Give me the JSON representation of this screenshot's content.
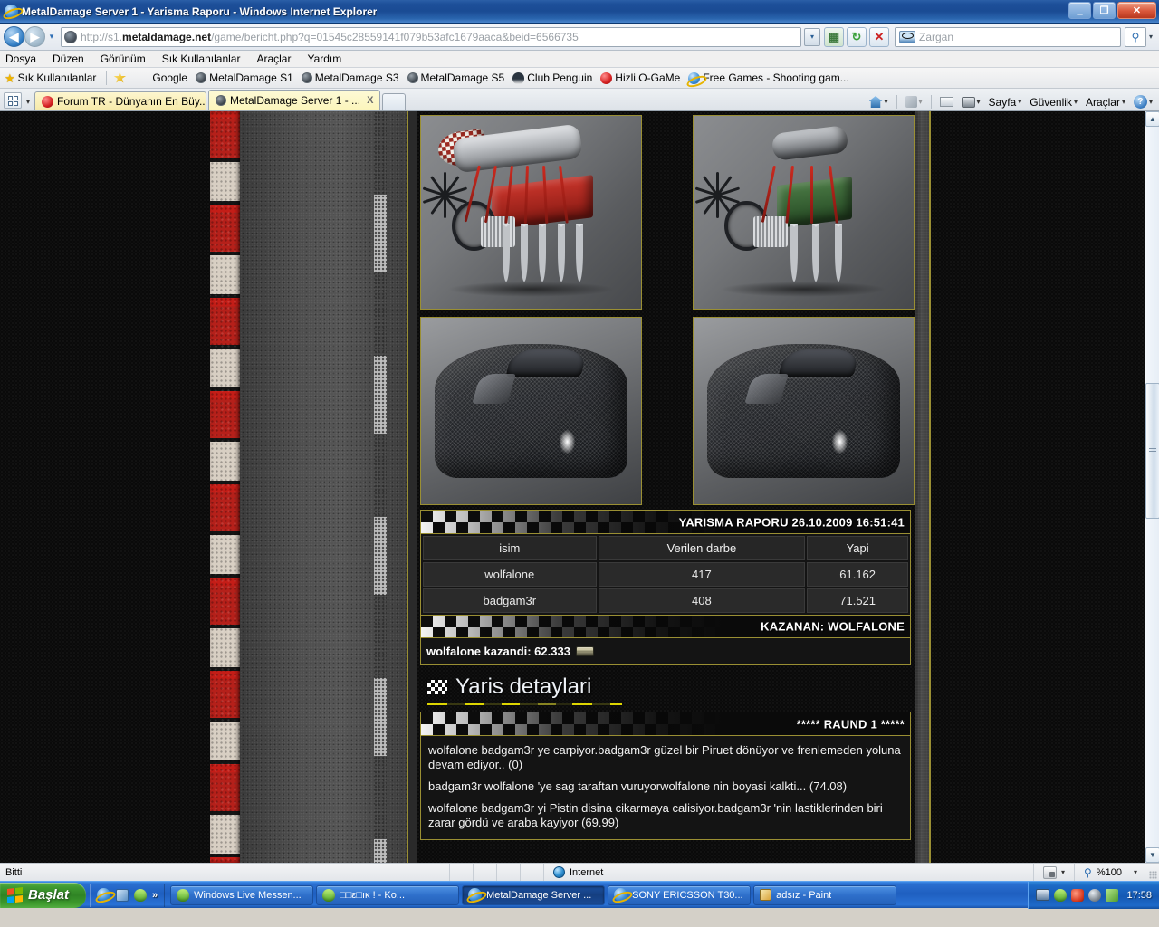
{
  "window": {
    "title": "MetalDamage Server 1 - Yarisma Raporu - Windows Internet Explorer",
    "icon": "internet-explorer-icon",
    "minimize_label": "_",
    "restore_label": "❐",
    "close_label": "✕"
  },
  "nav": {
    "back_label": "◀",
    "forward_label": "▶",
    "recent_caret": "▾",
    "url_scheme": "http://s1.",
    "url_domain": "metaldamage.net",
    "url_path": "/game/bericht.php?q=01545c28559141f079b53afc1679aaca&beid=6566735",
    "url_full": "http://s1.metaldamage.net/game/bericht.php?q=01545c28559141f079b53afc1679aaca&beid=6566735",
    "address_dropdown_label": "▾",
    "compat_view_label": "⬚",
    "refresh_label": "↻",
    "stop_label": "✕",
    "search_placeholder": "Zargan",
    "search_go_label": "⚲",
    "search_caret": "▾"
  },
  "menu": {
    "items": [
      "Dosya",
      "Düzen",
      "Görünüm",
      "Sık Kullanılanlar",
      "Araçlar",
      "Yardım"
    ]
  },
  "favorites": {
    "button_label": "Sık Kullanılanlar",
    "add_icon": "add-favorite-icon",
    "items": [
      {
        "label": "Google",
        "icon": "google-icon"
      },
      {
        "label": "MetalDamage S1",
        "icon": "metaldamage-icon"
      },
      {
        "label": "MetalDamage S3",
        "icon": "metaldamage-icon"
      },
      {
        "label": "MetalDamage S5",
        "icon": "metaldamage-icon"
      },
      {
        "label": "Club Penguin",
        "icon": "club-penguin-icon"
      },
      {
        "label": "Hizli O-GaMe",
        "icon": "ogame-icon"
      },
      {
        "label": "Free Games - Shooting gam...",
        "icon": "internet-explorer-icon"
      }
    ]
  },
  "tabs": {
    "quick_tabs_label": "Quick Tabs",
    "tab_list_caret": "▾",
    "items": [
      {
        "label": "Forum TR - Dünyanın En Büy...",
        "icon": "forum-tr-icon",
        "active": false
      },
      {
        "label": "MetalDamage Server 1 - ...",
        "icon": "metaldamage-icon",
        "active": true
      }
    ],
    "close_label": "X"
  },
  "command_bar": {
    "home_label": "",
    "home_caret": "▾",
    "feeds_caret": "▾",
    "read_mail_label": "",
    "print_caret": "▾",
    "page_label": "Sayfa",
    "security_label": "Güvenlik",
    "tools_label": "Araçlar",
    "help_label": "?",
    "help_caret": "▾"
  },
  "page": {
    "images": [
      {
        "name": "engine-red-v8",
        "alt": "Red V8 engine with turbocharger"
      },
      {
        "name": "engine-green-v4",
        "alt": "Green engine with air intake"
      },
      {
        "name": "hood-carbon-left",
        "alt": "Carbon fiber hood"
      },
      {
        "name": "hood-carbon-right",
        "alt": "Carbon fiber hood"
      }
    ],
    "report": {
      "header": "YARISMA RAPORU 26.10.2009 16:51:41",
      "columns": [
        "isim",
        "Verilen darbe",
        "Yapi"
      ],
      "rows": [
        {
          "isim": "wolfalone",
          "verilen_darbe": "417",
          "yapi": "61.162"
        },
        {
          "isim": "badgam3r",
          "verilen_darbe": "408",
          "yapi": "71.521"
        }
      ],
      "winner_label": "KAZANAN: WOLFALONE",
      "prize_text": "wolfalone kazandi: 62.333",
      "prize_icon": "money-icon"
    },
    "details": {
      "section_title": "Yaris detaylari",
      "flag_icon": "checkered-flag-icon",
      "round_header": "***** RAUND 1 *****",
      "log": [
        "wolfalone badgam3r ye carpiyor.badgam3r güzel bir Piruet dönüyor ve frenlemeden yoluna devam ediyor.. (0)",
        "badgam3r wolfalone 'ye sag taraftan vuruyorwolfalone nin boyasi kalkti... (74.08)",
        "wolfalone badgam3r yi Pistin disina cikarmaya calisiyor.badgam3r 'nin lastiklerinden biri zarar gördü ve araba kayiyor (69.99)"
      ]
    }
  },
  "scrollbar": {
    "up_label": "▲",
    "down_label": "▼"
  },
  "status": {
    "text": "Bitti",
    "zone_label": "Internet",
    "zone_icon": "globe-icon",
    "protected_icon": "protected-mode-icon",
    "protected_caret": "▾",
    "zoom_icon": "zoom-icon",
    "zoom_label": "%100",
    "zoom_caret": "▾"
  },
  "taskbar": {
    "start_label": "Başlat",
    "start_icon": "windows-logo-icon",
    "quick_launch": [
      {
        "icon": "internet-explorer-icon",
        "name": "quick-launch-ie"
      },
      {
        "icon": "show-desktop-icon",
        "name": "quick-launch-show-desktop"
      },
      {
        "icon": "messenger-icon",
        "name": "quick-launch-messenger"
      }
    ],
    "quick_launch_more": "»",
    "tasks": [
      {
        "label": "Windows Live Messen...",
        "icon": "messenger-icon",
        "active": false
      },
      {
        "label": "□□ε□ıκ ! - Ko...",
        "icon": "messenger-contact-icon",
        "active": false
      },
      {
        "label": "MetalDamage Server ...",
        "icon": "internet-explorer-icon",
        "active": true
      },
      {
        "label": "SONY ERICSSON T30...",
        "icon": "internet-explorer-icon",
        "active": false
      },
      {
        "label": "adsız - Paint",
        "icon": "paint-icon",
        "active": false
      }
    ],
    "tray_icons": [
      "network-icon",
      "messenger-tray-icon",
      "volume-icon",
      "shield-icon",
      "update-icon"
    ],
    "clock": "17:58"
  },
  "colors": {
    "accent_gold": "#9a8f33",
    "panel_bg": "#141414",
    "cell_bg": "#2a2a2a",
    "yellow_rule": "#e8e000",
    "curb_red": "#c41d17"
  }
}
